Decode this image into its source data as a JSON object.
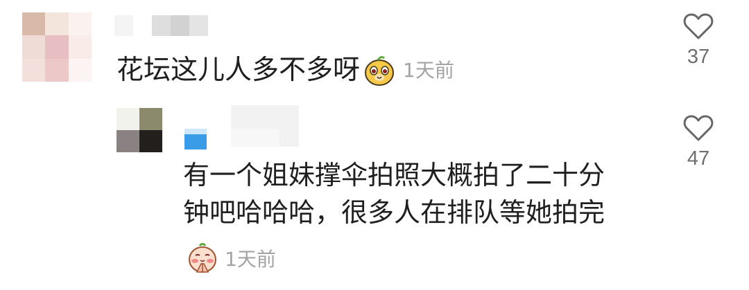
{
  "comment": {
    "text": "花坛这儿人多不多呀",
    "time": "1天前",
    "likes": "37",
    "emoji_icon": "cute-dog-face-emoji"
  },
  "reply": {
    "text_line1": "有一个姐妹撑伞拍照大概拍了二十分",
    "text_line2": "钟吧哈哈哈，很多人在排队等她拍完",
    "time": "1天前",
    "likes": "47",
    "emoji_icon": "bashful-praying-emoji"
  },
  "colors": {
    "text": "#1f1f1f",
    "meta": "#a3a3a3",
    "like_count": "#6e6e6e",
    "badge": "#3a9be6"
  }
}
